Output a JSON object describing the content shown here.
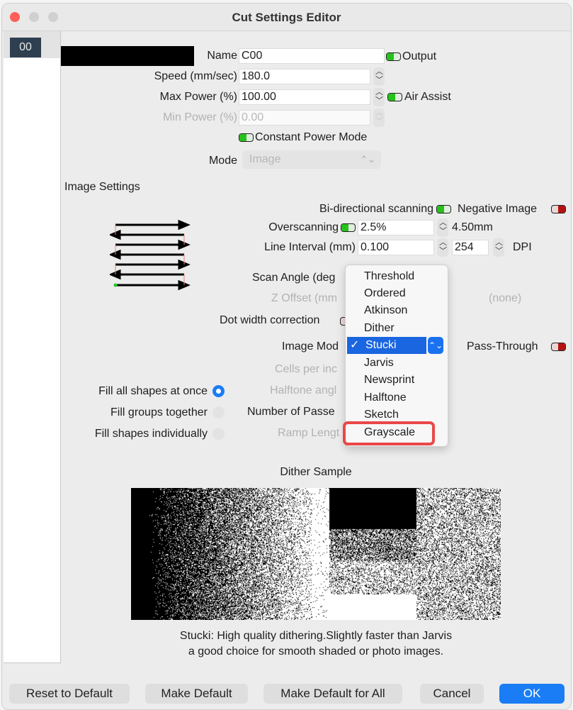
{
  "window": {
    "title": "Cut Settings Editor"
  },
  "sidebar": {
    "layers": [
      {
        "label": "00",
        "color": "#000000"
      }
    ]
  },
  "form": {
    "name": {
      "label": "Name",
      "value": "C00"
    },
    "output": {
      "label": "Output",
      "on": true
    },
    "speed": {
      "label": "Speed (mm/sec)",
      "value": "180.0"
    },
    "max_power": {
      "label": "Max Power (%)",
      "value": "100.00"
    },
    "air_assist": {
      "label": "Air Assist",
      "on": true
    },
    "min_power": {
      "label": "Min Power (%)",
      "value": "0.00",
      "disabled": true
    },
    "constant_power": {
      "label": "Constant Power Mode",
      "on": true
    },
    "mode": {
      "label": "Mode",
      "value": "Image",
      "disabled": true
    }
  },
  "image_settings": {
    "heading": "Image Settings",
    "bidirectional": {
      "label": "Bi-directional scanning",
      "on": true
    },
    "negative_image": {
      "label": "Negative Image",
      "on": false
    },
    "overscanning": {
      "label": "Overscanning",
      "on": true,
      "value": "2.5%",
      "computed": "4.50mm"
    },
    "line_interval": {
      "label": "Line Interval (mm)",
      "value": "0.100",
      "dpi_value": "254",
      "dpi_label": "DPI"
    },
    "scan_angle": {
      "label": "Scan Angle (deg"
    },
    "z_offset": {
      "label": "Z Offset (mm",
      "disabled": true,
      "note": "(none)"
    },
    "dot_width": {
      "label": "Dot width correction"
    },
    "image_mode": {
      "label": "Image Mod",
      "selected": "Stucki"
    },
    "pass_through": {
      "label": "Pass-Through",
      "on": false
    },
    "cells_per_inch": {
      "label": "Cells per inc",
      "disabled": true
    },
    "halftone_angle": {
      "label": "Halftone angl",
      "disabled": true
    },
    "number_of_passes": {
      "label": "Number of Passe"
    },
    "ramp_length": {
      "label": "Ramp Lengt",
      "disabled": true
    }
  },
  "fill_options": [
    {
      "label": "Fill all shapes at once",
      "selected": true
    },
    {
      "label": "Fill groups together",
      "selected": false
    },
    {
      "label": "Fill shapes individually",
      "selected": false
    }
  ],
  "image_mode_menu": {
    "items": [
      "Threshold",
      "Ordered",
      "Atkinson",
      "Dither",
      "Stucki",
      "Jarvis",
      "Newsprint",
      "Halftone",
      "Sketch",
      "Grayscale"
    ],
    "checked": "Stucki",
    "check_glyph": "✓",
    "highlighted_annotation": "Grayscale"
  },
  "dither_sample": {
    "title": "Dither Sample",
    "description_line1": "Stucki: High quality dithering.Slightly faster than Jarvis",
    "description_line2": "a good choice for smooth shaded or photo images."
  },
  "buttons": {
    "reset": "Reset to Default",
    "make_default": "Make Default",
    "make_default_all": "Make Default for All",
    "cancel": "Cancel",
    "ok": "OK"
  },
  "colors": {
    "accent": "#1a7df5",
    "toggle_on": "#27c21a",
    "toggle_off": "#b51212",
    "annotation": "#ea4849"
  }
}
